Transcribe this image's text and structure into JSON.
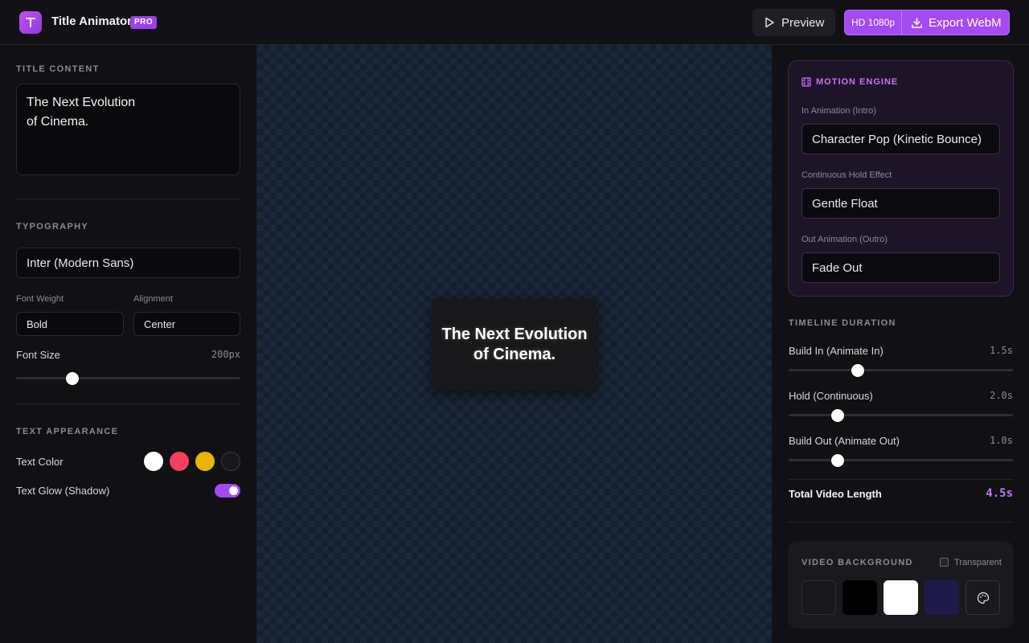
{
  "header": {
    "app_title": "Title Animator",
    "badge": "PRO",
    "preview_label": "Preview",
    "resolution_label": "HD 1080p",
    "export_label": "Export WebM",
    "accent_color": "#a34af1"
  },
  "left": {
    "title_content": {
      "heading": "TITLE CONTENT",
      "text": "The Next Evolution\nof Cinema."
    },
    "typography": {
      "heading": "TYPOGRAPHY",
      "font_family_value": "Inter (Modern Sans)",
      "font_weight_label": "Font Weight",
      "font_weight_value": "Bold",
      "alignment_label": "Alignment",
      "alignment_value": "Center",
      "font_size_label": "Font Size",
      "font_size_value": "200px",
      "font_size_slider_fraction": 0.25
    },
    "appearance": {
      "heading": "TEXT APPEARANCE",
      "text_color_label": "Text Color",
      "colors": [
        "#ffffff",
        "#f43f5e",
        "#eab308",
        "#18181b"
      ],
      "glow_label": "Text Glow (Shadow)",
      "glow_on": true
    }
  },
  "canvas": {
    "title_text": "The Next Evolution\nof Cinema."
  },
  "right": {
    "motion": {
      "heading": "MOTION ENGINE",
      "in_label": "In Animation (Intro)",
      "in_value": "Character Pop (Kinetic Bounce)",
      "hold_label": "Continuous Hold Effect",
      "hold_value": "Gentle Float",
      "out_label": "Out Animation (Outro)",
      "out_value": "Fade Out"
    },
    "timeline": {
      "heading": "TIMELINE DURATION",
      "build_in_label": "Build In (Animate In)",
      "build_in_value": "1.5s",
      "build_in_fraction": 0.31,
      "hold_label": "Hold (Continuous)",
      "hold_value": "2.0s",
      "hold_fraction": 0.22,
      "build_out_label": "Build Out (Animate Out)",
      "build_out_value": "1.0s",
      "build_out_fraction": 0.22,
      "total_label": "Total Video Length",
      "total_value": "4.5s"
    },
    "background": {
      "heading": "VIDEO BACKGROUND",
      "transparent_label": "Transparent",
      "transparent_checked": false,
      "swatches": [
        "#18181b",
        "#000000",
        "#ffffff",
        "#1e1b4b"
      ]
    }
  }
}
